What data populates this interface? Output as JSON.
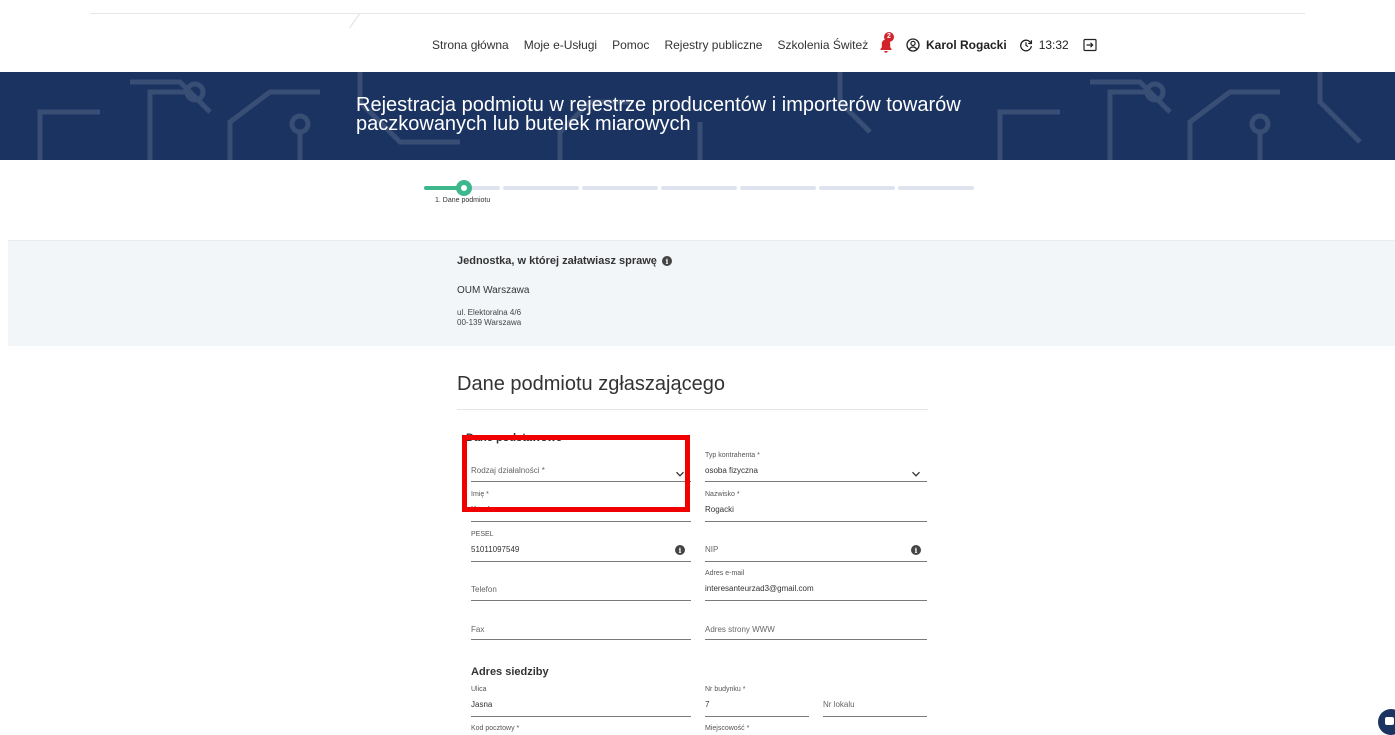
{
  "nav": {
    "items": [
      "Strona główna",
      "Moje e-Usługi",
      "Pomoc",
      "Rejestry publiczne",
      "Szkolenia Świteż"
    ]
  },
  "user": {
    "notifications_count": "2",
    "name": "Karol Rogacki",
    "session_time": "13:32",
    "icons": [
      "bell-icon",
      "user-circle-icon",
      "timer-icon",
      "logout-icon"
    ]
  },
  "hero": {
    "title": "Rejestracja podmiotu w rejestrze producentów i importerów towarów paczkowanych lub butelek miarowych"
  },
  "stepper": {
    "current_step_label": "1. Dane podmiotu",
    "total_steps": 7,
    "current_step": 1
  },
  "unit": {
    "title": "Jednostka, w której załatwiasz sprawę",
    "name": "OUM Warszawa",
    "address_line1": "ul. Elektoralna 4/6",
    "address_line2": "00-139 Warszawa"
  },
  "form": {
    "section_title": "Dane podmiotu zgłaszającego",
    "basic_title": "Dane podstawowe",
    "activity_type_label": "Rodzaj działalności *",
    "contractor_type_label": "Typ kontrahenta *",
    "contractor_type_value": "osoba fizyczna",
    "first_name_label": "Imię *",
    "first_name_value": "Karol",
    "last_name_label": "Nazwisko *",
    "last_name_value": "Rogacki",
    "pesel_label": "PESEL",
    "pesel_value": "51011097549",
    "nip_label": "NIP",
    "phone_label": "Telefon",
    "email_label": "Adres e-mail",
    "email_value": "interesanteurzad3@gmail.com",
    "fax_label": "Fax",
    "www_label": "Adres strony WWW",
    "address_title": "Adres siedziby",
    "street_label": "Ulica",
    "street_value": "Jasna",
    "building_label": "Nr budynku *",
    "building_value": "7",
    "apartment_label": "Nr lokalu",
    "postal_label": "Kod pocztowy *",
    "city_label": "Miejscowość *"
  },
  "colors": {
    "hero_bg": "#1b3361",
    "progress": "#3cb88c",
    "highlight": "#f00000",
    "badge": "#d2232a"
  }
}
